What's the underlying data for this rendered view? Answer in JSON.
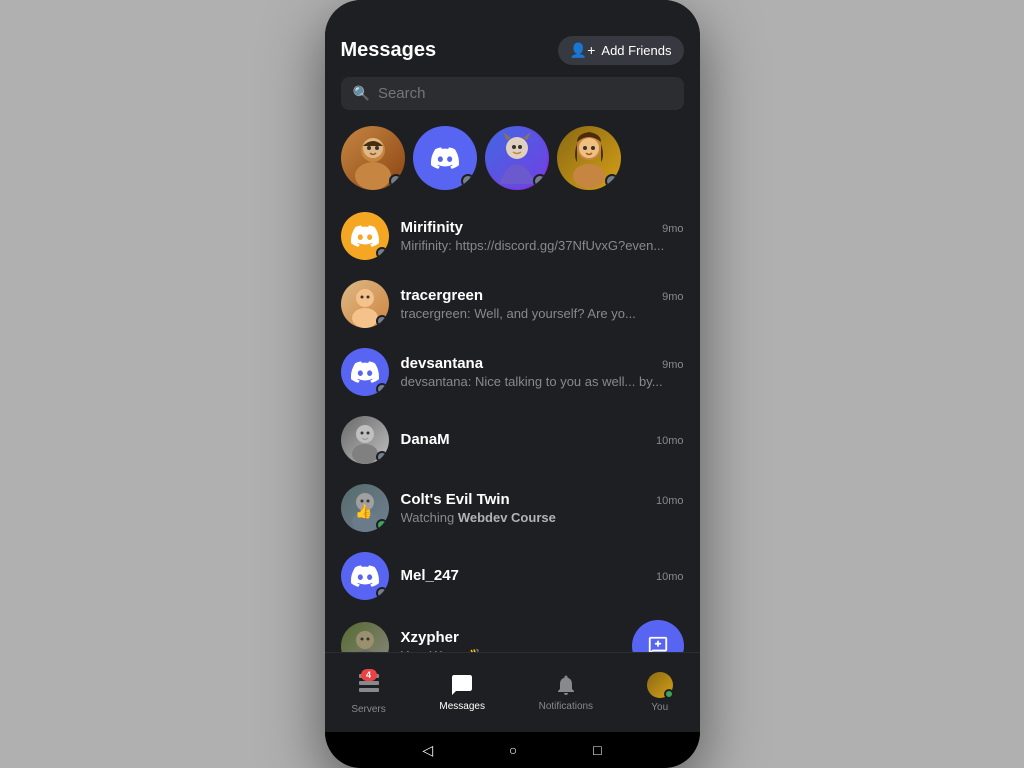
{
  "header": {
    "title": "Messages",
    "add_friends_label": "Add Friends"
  },
  "search": {
    "placeholder": "Search"
  },
  "stories": [
    {
      "id": "story-1",
      "type": "photo",
      "cssClass": "avatar-photo-1",
      "status": "offline"
    },
    {
      "id": "story-2",
      "type": "discord",
      "cssClass": "discord-blue",
      "status": "offline"
    },
    {
      "id": "story-3",
      "type": "photo",
      "cssClass": "avatar-photo-4",
      "status": "offline"
    },
    {
      "id": "story-4",
      "type": "photo",
      "cssClass": "avatar-photo-6",
      "status": "offline"
    }
  ],
  "messages": [
    {
      "id": "msg-1",
      "name": "Mirifinity",
      "time": "9mo",
      "preview": "Mirifinity: https://discord.gg/37NfUvxG?even...",
      "avatarType": "discord-orange",
      "status": "offline"
    },
    {
      "id": "msg-2",
      "name": "tracergreen",
      "time": "9mo",
      "preview": "tracergreen: Well, and yourself? Are yo...",
      "avatarType": "photo-2",
      "status": "offline"
    },
    {
      "id": "msg-3",
      "name": "devsantana",
      "time": "9mo",
      "preview": "devsantana: Nice talking to you as well... by...",
      "avatarType": "discord-blue",
      "status": "offline"
    },
    {
      "id": "msg-4",
      "name": "DanaM",
      "time": "10mo",
      "preview": "",
      "avatarType": "photo-3",
      "status": "offline"
    },
    {
      "id": "msg-5",
      "name": "Colt's Evil Twin",
      "time": "10mo",
      "preview": "Watching Webdev Course",
      "avatarType": "photo-5",
      "status": "online"
    },
    {
      "id": "msg-6",
      "name": "Mel_247",
      "time": "10mo",
      "preview": "",
      "avatarType": "discord-blue",
      "status": "offline"
    },
    {
      "id": "msg-7",
      "name": "Xzypher",
      "time": "",
      "preview": "You: Wave 👋",
      "avatarType": "photo-4",
      "status": "offline",
      "hasFab": true
    }
  ],
  "bottomNav": {
    "items": [
      {
        "id": "servers",
        "label": "Servers",
        "icon": "🖥",
        "badge": "4",
        "active": false
      },
      {
        "id": "messages",
        "label": "Messages",
        "icon": "💬",
        "badge": "",
        "active": true
      },
      {
        "id": "notifications",
        "label": "Notifications",
        "icon": "🔔",
        "badge": "",
        "active": false
      },
      {
        "id": "you",
        "label": "You",
        "icon": "avatar",
        "badge": "",
        "active": false
      }
    ]
  },
  "systemNav": {
    "back": "◁",
    "home": "○",
    "recent": "□"
  }
}
